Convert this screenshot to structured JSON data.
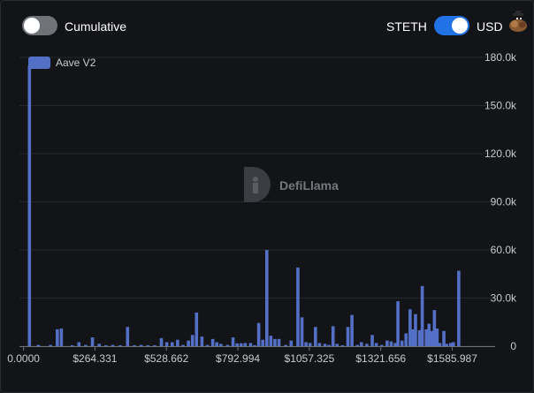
{
  "controls": {
    "cumulative_label": "Cumulative",
    "denomination_left_label": "STETH",
    "denomination_right_label": "USD",
    "cumulative_on": false,
    "usd_on": true
  },
  "watermark": {
    "text": "DefiLlama"
  },
  "chart_data": {
    "type": "bar",
    "series": [
      {
        "name": "Aave V2",
        "color": "#5470c6"
      }
    ],
    "x_ticks": [
      "0.0000",
      "$264.331",
      "$528.662",
      "$792.994",
      "$1057.325",
      "$1321.656",
      "$1585.987"
    ],
    "x_tick_values": [
      0,
      264.331,
      528.662,
      792.994,
      1057.325,
      1321.656,
      1585.987
    ],
    "y_ticks": [
      "0",
      "30.0k",
      "60.0k",
      "90.0k",
      "120.0k",
      "150.0k",
      "180.0k"
    ],
    "y_tick_values": [
      0,
      30000,
      60000,
      90000,
      120000,
      150000,
      180000
    ],
    "ylim": [
      0,
      180000
    ],
    "xlim": [
      -15,
      1630
    ],
    "points": [
      [
        22,
        175000
      ],
      [
        55,
        800
      ],
      [
        100,
        800
      ],
      [
        125,
        10500
      ],
      [
        140,
        11000
      ],
      [
        180,
        600
      ],
      [
        205,
        2500
      ],
      [
        230,
        800
      ],
      [
        255,
        5500
      ],
      [
        280,
        1500
      ],
      [
        305,
        600
      ],
      [
        330,
        800
      ],
      [
        358,
        600
      ],
      [
        385,
        12000
      ],
      [
        410,
        600
      ],
      [
        435,
        800
      ],
      [
        460,
        600
      ],
      [
        485,
        600
      ],
      [
        510,
        5000
      ],
      [
        530,
        2500
      ],
      [
        550,
        2500
      ],
      [
        570,
        4000
      ],
      [
        590,
        800
      ],
      [
        610,
        3500
      ],
      [
        625,
        7000
      ],
      [
        640,
        21000
      ],
      [
        660,
        6000
      ],
      [
        680,
        800
      ],
      [
        700,
        4500
      ],
      [
        715,
        2500
      ],
      [
        730,
        1500
      ],
      [
        755,
        800
      ],
      [
        775,
        5500
      ],
      [
        790,
        1800
      ],
      [
        805,
        1800
      ],
      [
        820,
        2000
      ],
      [
        840,
        2000
      ],
      [
        855,
        600
      ],
      [
        870,
        14500
      ],
      [
        885,
        4000
      ],
      [
        900,
        60000
      ],
      [
        915,
        6500
      ],
      [
        930,
        4500
      ],
      [
        945,
        4500
      ],
      [
        970,
        800
      ],
      [
        990,
        3500
      ],
      [
        1015,
        49000
      ],
      [
        1030,
        18000
      ],
      [
        1045,
        2500
      ],
      [
        1060,
        2000
      ],
      [
        1080,
        12000
      ],
      [
        1095,
        2000
      ],
      [
        1115,
        1500
      ],
      [
        1130,
        800
      ],
      [
        1145,
        12500
      ],
      [
        1160,
        1500
      ],
      [
        1180,
        600
      ],
      [
        1200,
        12000
      ],
      [
        1215,
        19500
      ],
      [
        1235,
        800
      ],
      [
        1250,
        2500
      ],
      [
        1270,
        1500
      ],
      [
        1290,
        7000
      ],
      [
        1305,
        2000
      ],
      [
        1325,
        800
      ],
      [
        1345,
        3500
      ],
      [
        1360,
        3000
      ],
      [
        1375,
        2000
      ],
      [
        1385,
        28000
      ],
      [
        1400,
        3500
      ],
      [
        1415,
        8000
      ],
      [
        1430,
        23000
      ],
      [
        1440,
        10500
      ],
      [
        1450,
        20000
      ],
      [
        1465,
        10000
      ],
      [
        1475,
        37500
      ],
      [
        1490,
        10500
      ],
      [
        1500,
        14000
      ],
      [
        1510,
        9500
      ],
      [
        1520,
        22500
      ],
      [
        1530,
        11000
      ],
      [
        1540,
        2000
      ],
      [
        1555,
        9500
      ],
      [
        1565,
        1500
      ],
      [
        1580,
        2000
      ],
      [
        1590,
        2500
      ],
      [
        1610,
        47000
      ]
    ],
    "grid": true,
    "legend": "top-left"
  }
}
